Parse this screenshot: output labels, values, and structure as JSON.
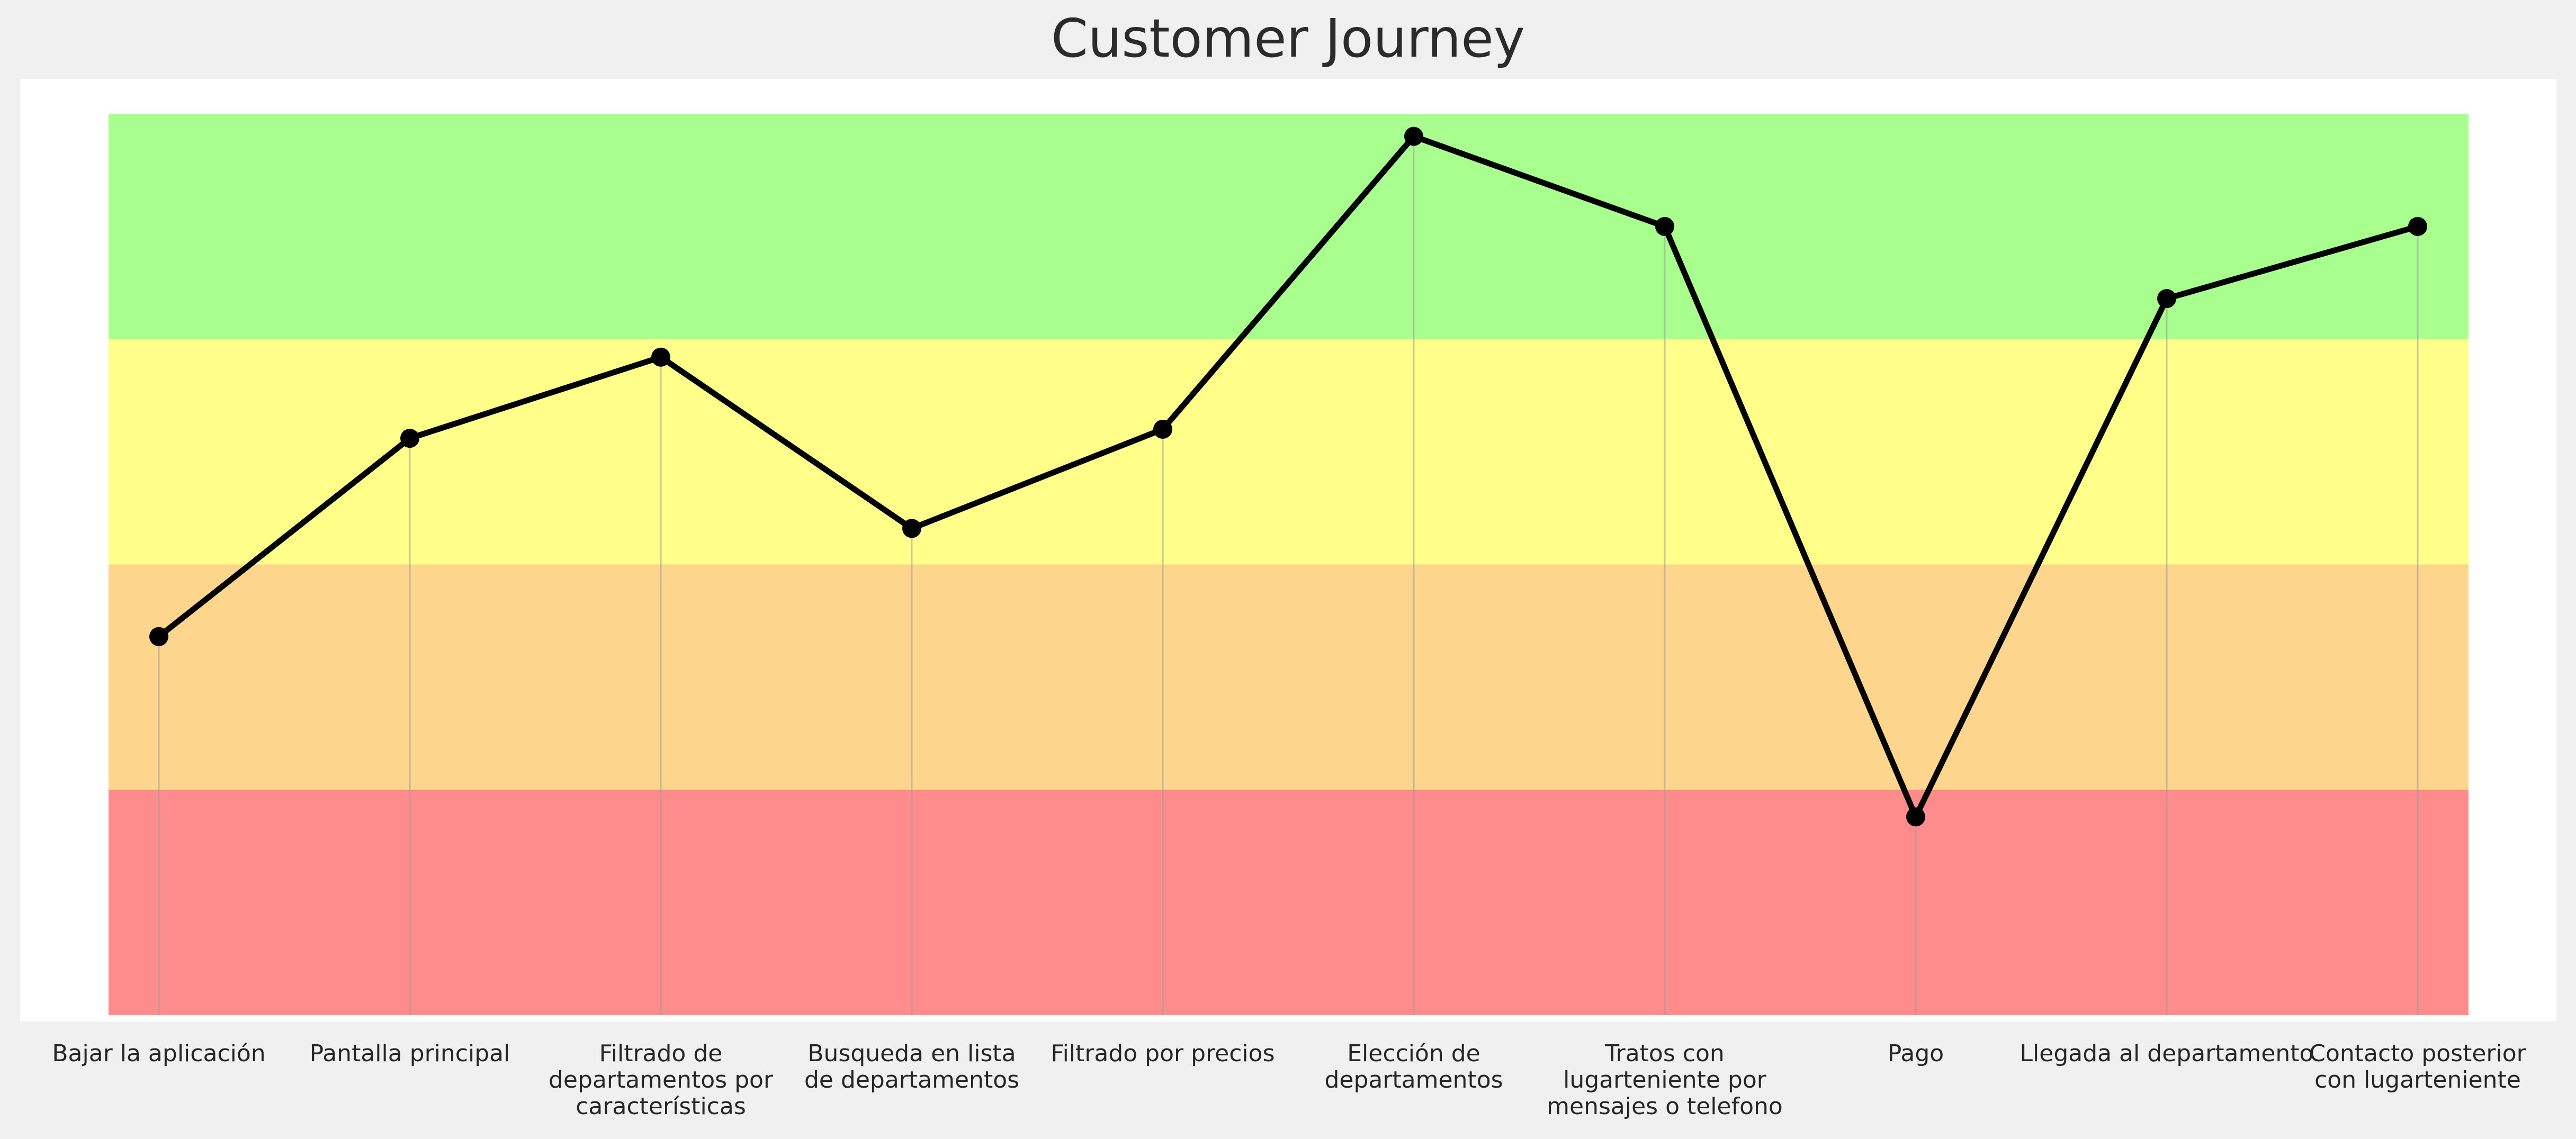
{
  "chart_data": {
    "type": "line",
    "title": "Customer Journey",
    "xlabel": "",
    "ylabel": "",
    "categories": [
      "Bajar la aplicación",
      "Pantalla principal",
      "Filtrado de\ndepartamentos por\ncaracterísticas",
      "Busqueda en lista\nde departamentos",
      "Filtrado por precios",
      "Elección de\ndepartamentos",
      "Tratos con\nlugarteniente por\nmensajes o telefono",
      "Pago",
      "Llegada al departamento",
      "Contacto posterior\ncon lugarteniente"
    ],
    "series": [
      {
        "values": [
          1.68,
          2.56,
          2.92,
          2.16,
          2.6,
          3.9,
          3.5,
          0.88,
          3.18,
          3.5
        ]
      }
    ],
    "ylim": [
      0,
      4
    ],
    "bands": [
      {
        "from": 3,
        "to": 4,
        "color": "#a8ff8e"
      },
      {
        "from": 2,
        "to": 3,
        "color": "#ffff8a"
      },
      {
        "from": 1,
        "to": 2,
        "color": "#fed58c"
      },
      {
        "from": 0,
        "to": 1,
        "color": "#ff8c8c"
      }
    ],
    "line_color": "#000000",
    "marker_color": "#000000",
    "grid": "vertical",
    "legend": "none"
  }
}
